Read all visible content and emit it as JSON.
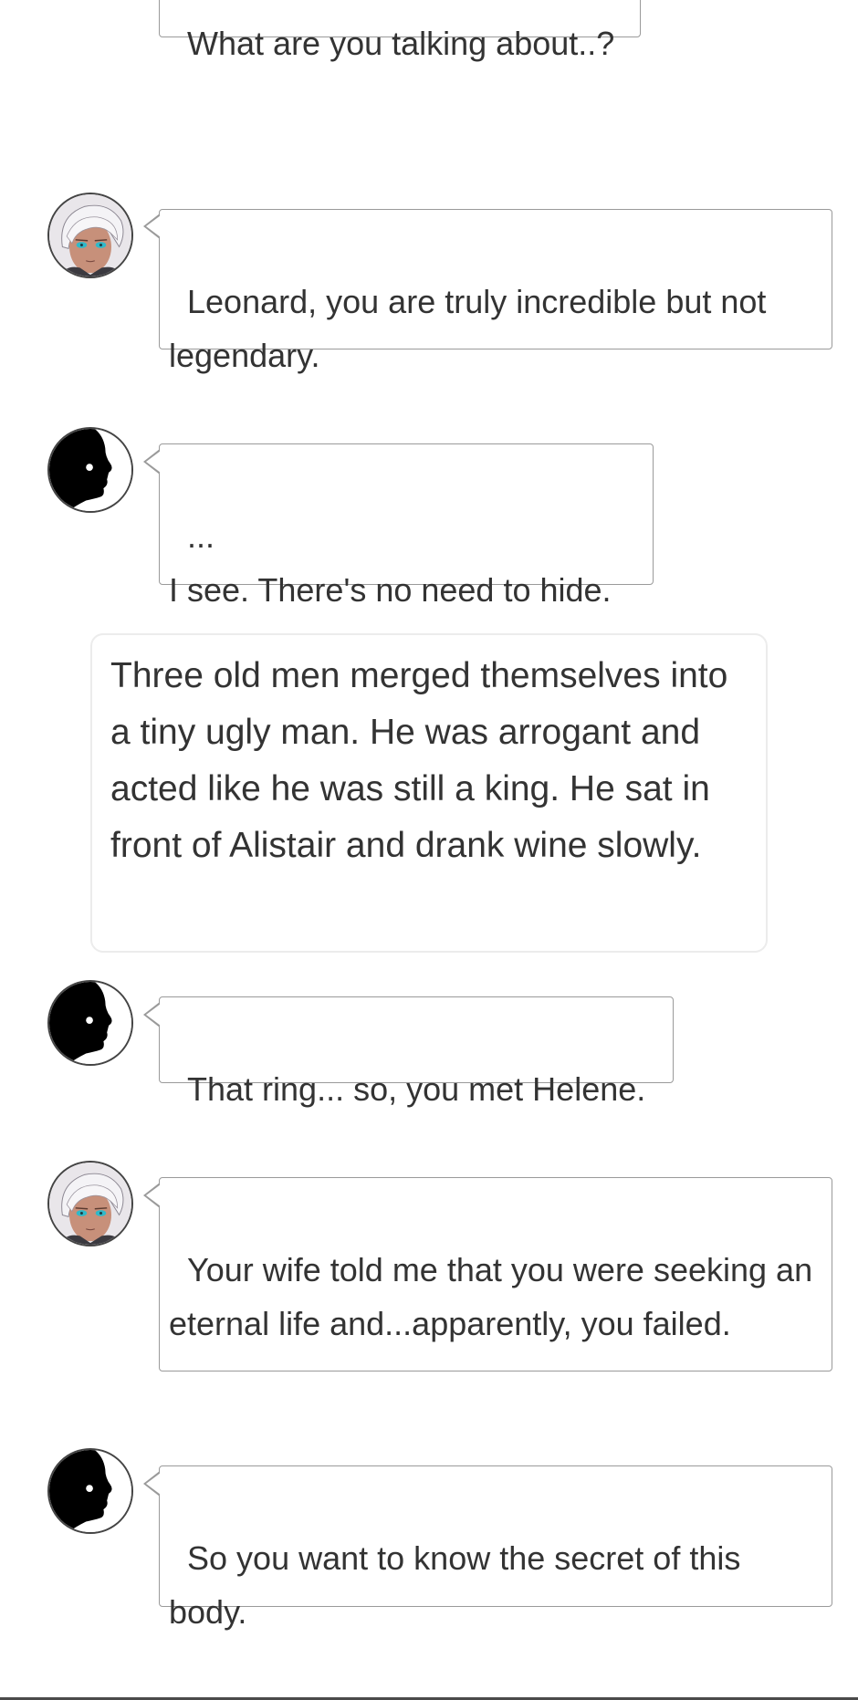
{
  "conversation": {
    "messages": [
      {
        "speaker": "unknown",
        "text": "What are you talking about..?"
      },
      {
        "speaker": "white-haired",
        "text": "Leonard, you are truly incredible but not legendary."
      },
      {
        "speaker": "silhouette",
        "text": "...\nI see. There's no need to hide."
      },
      {
        "speaker": "narration",
        "text": "Three old men merged themselves into a tiny ugly man. He was arrogant and acted like he was still a king. He sat in front of Alistair and drank wine slowly."
      },
      {
        "speaker": "silhouette",
        "text": "That ring... so, you met Helene."
      },
      {
        "speaker": "white-haired",
        "text": "Your wife told me that you were seeking an eternal life and...apparently, you failed."
      },
      {
        "speaker": "silhouette",
        "text": "So you want to know the secret of this body."
      }
    ]
  },
  "colors": {
    "bubble_border": "#9a9a9a",
    "text": "#333333",
    "narration_border": "#ececec"
  }
}
